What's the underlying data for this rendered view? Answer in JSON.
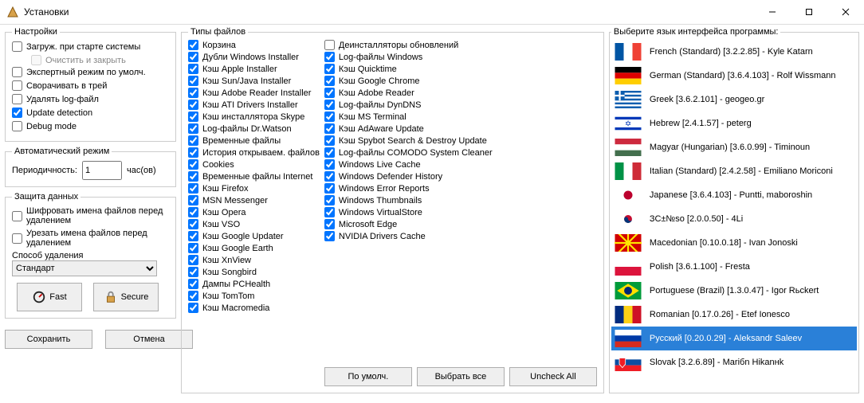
{
  "window": {
    "title": "Установки",
    "min_tip": "Minimize",
    "max_tip": "Maximize",
    "close_tip": "Close"
  },
  "settings_group": "Настройки",
  "settings": [
    {
      "label": "Загруж. при старте системы",
      "checked": false
    },
    {
      "label": "Очистить и закрыть",
      "checked": false,
      "sub": true,
      "disabled": true
    },
    {
      "label": "Экспертный режим по умолч.",
      "checked": false
    },
    {
      "label": "Сворачивать в трей",
      "checked": false
    },
    {
      "label": "Удалять log-файл",
      "checked": false
    },
    {
      "label": "Update detection",
      "checked": true
    },
    {
      "label": "Debug mode",
      "checked": false
    }
  ],
  "auto_group": "Автоматический режим",
  "auto": {
    "label": "Периодичность:",
    "value": 1,
    "unit": "час(ов)"
  },
  "protect_group": "Защита данных",
  "protect": [
    {
      "label": "Шифровать имена файлов перед удалением",
      "checked": false
    },
    {
      "label": "Урезать имена файлов перед удалением",
      "checked": false
    }
  ],
  "delete_method_label": "Способ удаления",
  "delete_method_value": "Стандарт",
  "speed": {
    "fast": "Fast",
    "secure": "Secure"
  },
  "buttons": {
    "save": "Сохранить",
    "cancel": "Отмена",
    "defaults": "По умолч.",
    "select_all": "Выбрать все",
    "uncheck_all": "Uncheck All"
  },
  "filetypes_group": "Типы файлов",
  "filetypes_left": [
    "Корзина",
    "Дубли Windows Installer",
    "Кэш Apple Installer",
    "Кэш Sun/Java Installer",
    "Кэш Adobe Reader Installer",
    "Кэш ATI Drivers Installer",
    "Кэш инсталлятора Skype",
    "Log-файлы Dr.Watson",
    "Временные файлы",
    "История открываем. файлов",
    "Cookies",
    "Временные файлы Internet",
    "Кэш Firefox",
    "MSN Messenger",
    "Кэш Opera",
    "Кэш VSO",
    "Кэш Google Updater",
    "Кэш Google Earth",
    "Кэш XnView",
    "Кэш Songbird",
    "Дампы PCHealth",
    "Кэш TomTom",
    "Кэш Macromedia"
  ],
  "filetypes_right": [
    {
      "label": "Деинсталляторы обновлений",
      "checked": false
    },
    {
      "label": "Log-файлы Windows",
      "checked": true
    },
    {
      "label": "Кэш Quicktime",
      "checked": true
    },
    {
      "label": "Кэш Google Chrome",
      "checked": true
    },
    {
      "label": "Кэш Adobe Reader",
      "checked": true
    },
    {
      "label": "Log-файлы DynDNS",
      "checked": true
    },
    {
      "label": "Кэш MS Terminal",
      "checked": true
    },
    {
      "label": "Кэш AdAware Update",
      "checked": true
    },
    {
      "label": "Кэш Spybot Search & Destroy Update",
      "checked": true
    },
    {
      "label": "Log-файлы COMODO System Cleaner",
      "checked": true
    },
    {
      "label": "Windows Live Cache",
      "checked": true
    },
    {
      "label": "Windows Defender History",
      "checked": true
    },
    {
      "label": "Windows Error Reports",
      "checked": true
    },
    {
      "label": "Windows Thumbnails",
      "checked": true
    },
    {
      "label": "Windows VirtualStore",
      "checked": true
    },
    {
      "label": "Microsoft Edge",
      "checked": true
    },
    {
      "label": "NVIDIA Drivers Cache",
      "checked": true
    }
  ],
  "lang_group": "Выберите язык интерфейса программы:",
  "languages": [
    {
      "name": "French (Standard) [3.2.2.85] - Kyle Katarn",
      "flag": "fr"
    },
    {
      "name": "German (Standard) [3.6.4.103] - Rolf Wissmann",
      "flag": "de"
    },
    {
      "name": "Greek [3.6.2.101] - geogeo.gr",
      "flag": "gr"
    },
    {
      "name": "Hebrew [2.4.1.57] - peterg",
      "flag": "il"
    },
    {
      "name": "Magyar (Hungarian) [3.6.0.99] - Timinoun",
      "flag": "hu"
    },
    {
      "name": "Italian (Standard) [2.4.2.58] - Emiliano Moriconi",
      "flag": "it"
    },
    {
      "name": "Japanese [3.6.4.103] - Puntti, maboroshin",
      "flag": "jp"
    },
    {
      "name": "ЗС±№so [2.0.0.50] - 4Li",
      "flag": "kr"
    },
    {
      "name": "Macedonian [0.10.0.18] - Ivan Jonoski",
      "flag": "mk"
    },
    {
      "name": "Polish [3.6.1.100] - Fresta",
      "flag": "pl"
    },
    {
      "name": "Portuguese (Brazil) [1.3.0.47] - Igor Rьckert",
      "flag": "br"
    },
    {
      "name": "Romanian [0.17.0.26] - Etef Ionesco",
      "flag": "ro"
    },
    {
      "name": "Русский [0.20.0.29] - Aleksandr Saleev",
      "flag": "ru",
      "selected": true
    },
    {
      "name": "Slovak [3.2.6.89] - Mariбn Hikanнk",
      "flag": "sk"
    }
  ]
}
